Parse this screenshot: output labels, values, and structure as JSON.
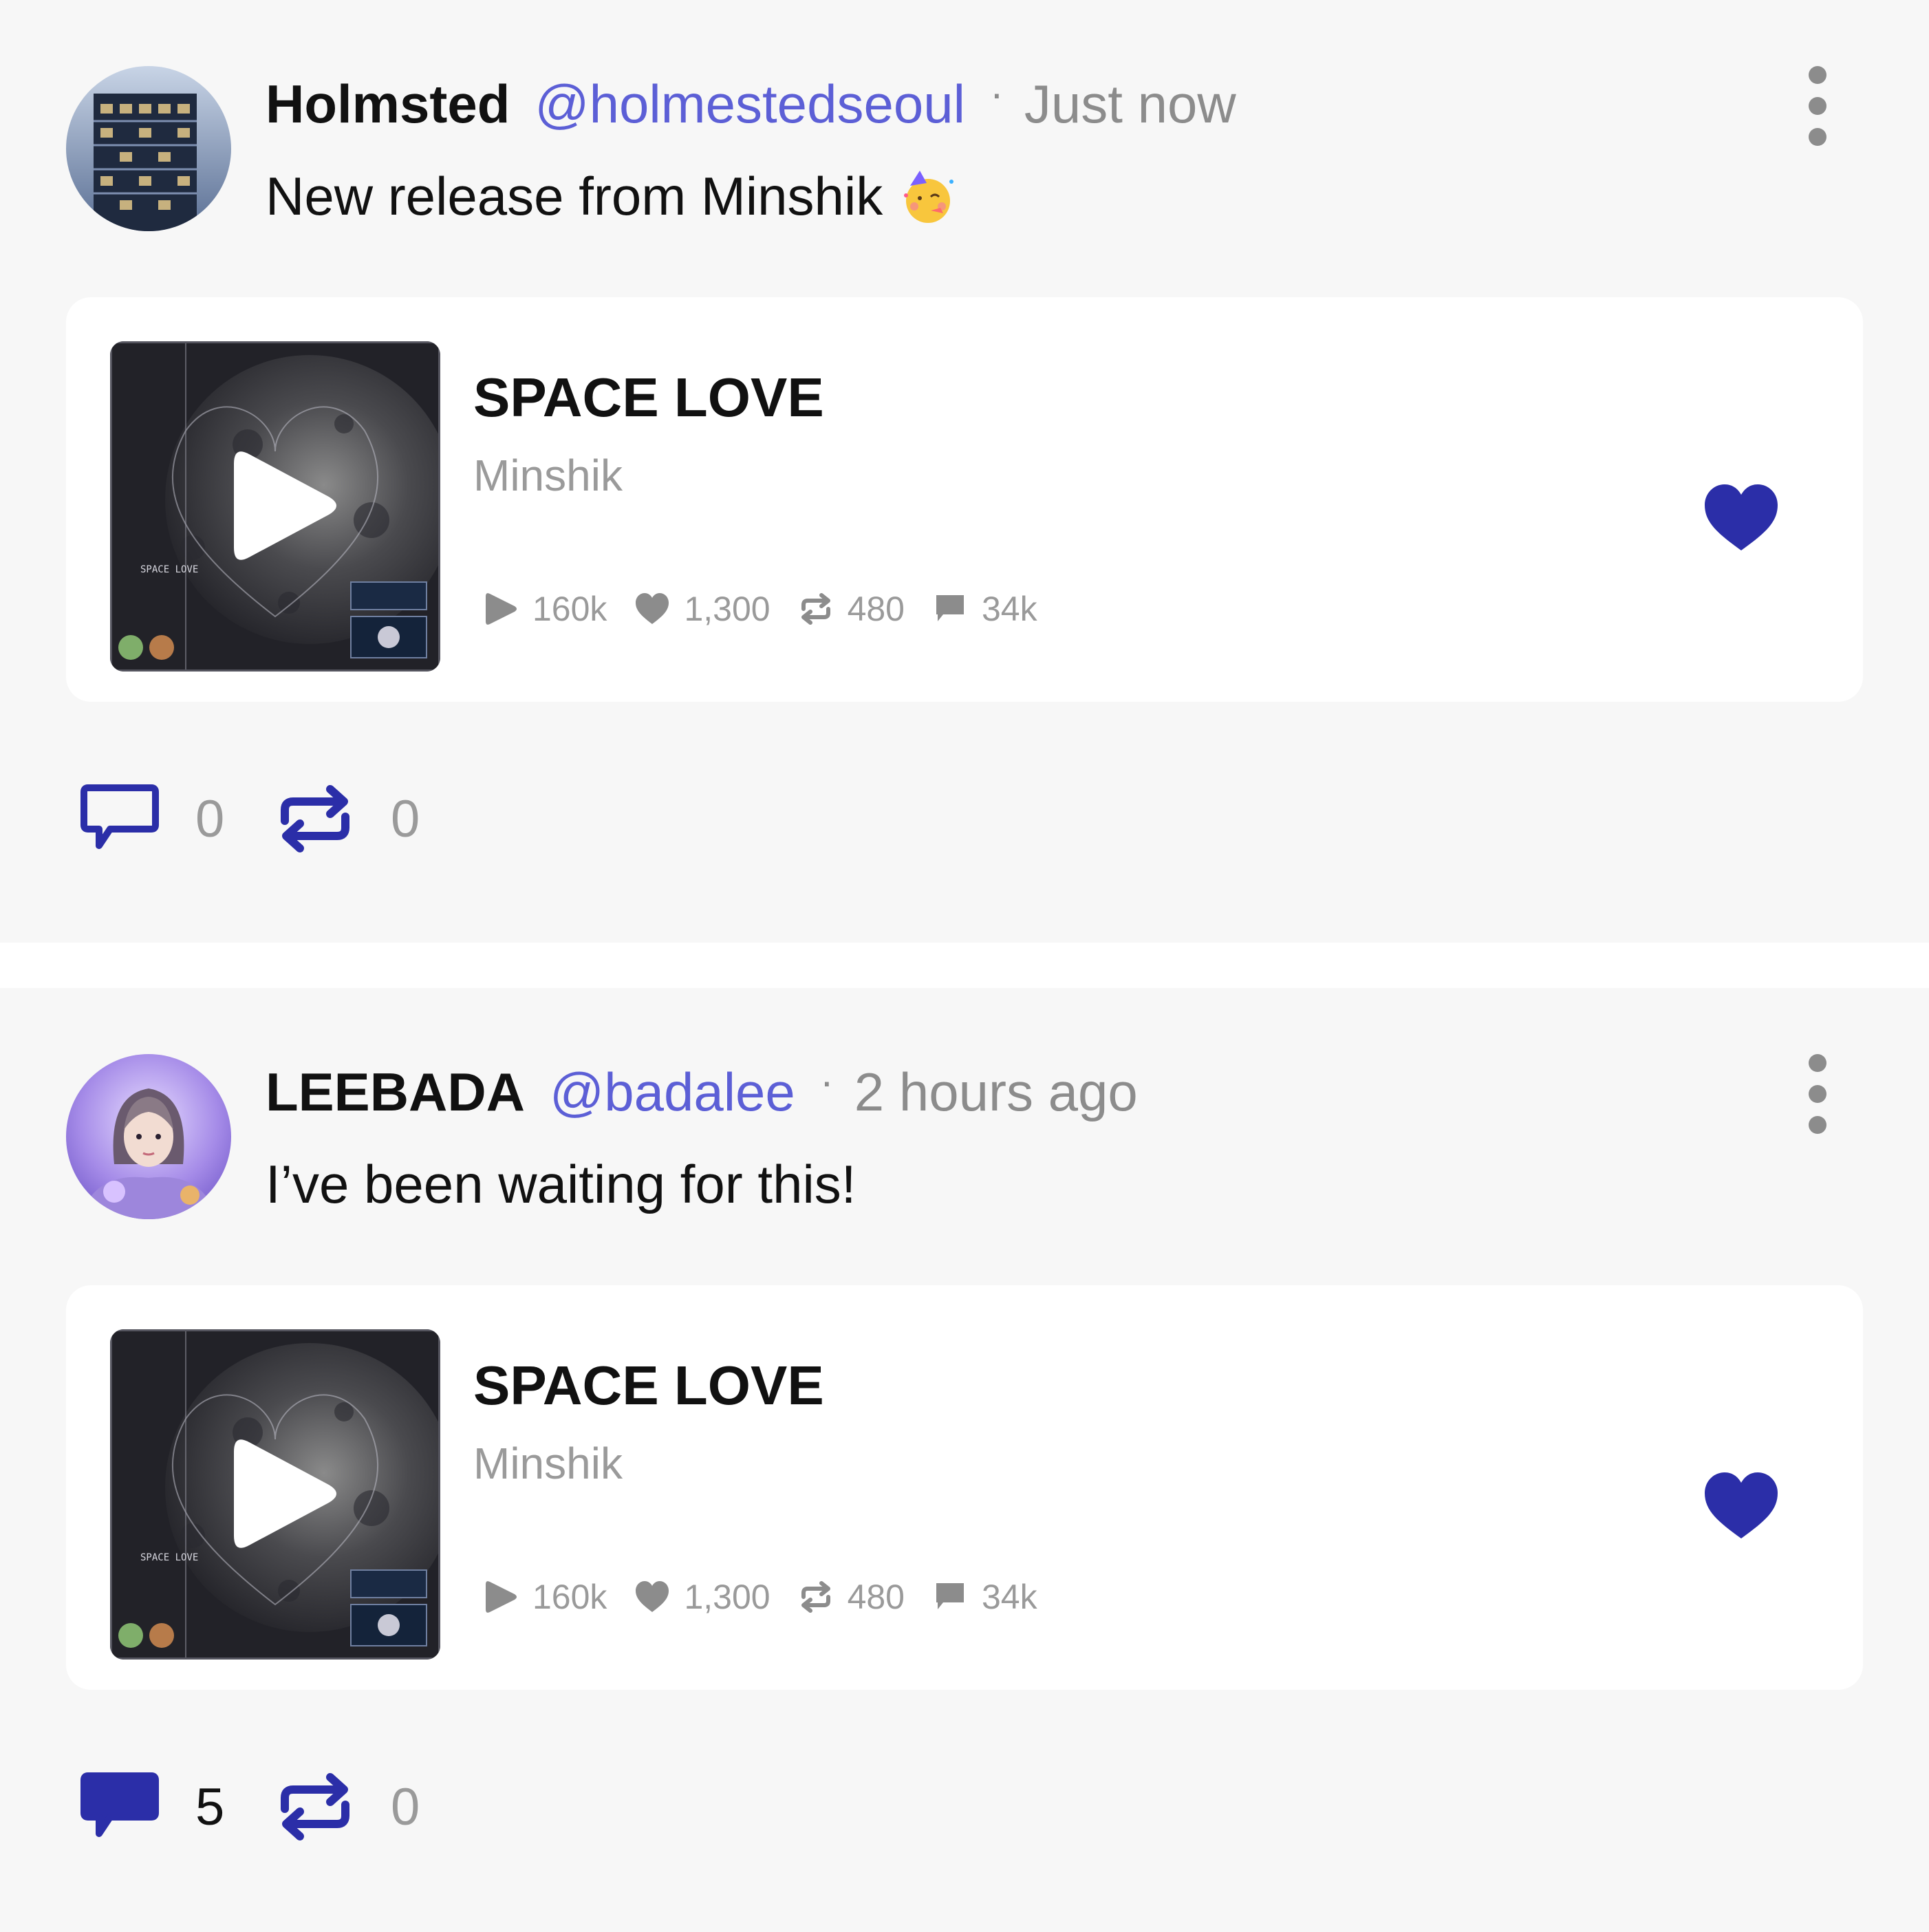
{
  "colors": {
    "accent": "#2b2ea8",
    "handle": "#5c5fd6",
    "muted": "#8c8c8c",
    "background": "#f7f7f7",
    "card": "#ffffff"
  },
  "posts": [
    {
      "author": {
        "name": "Holmsted",
        "handle": "@holmestedseoul",
        "avatar_icon": "building-avatar"
      },
      "separator": "·",
      "time": "Just now",
      "text": "New release from Minshik",
      "emoji": "partying-face-emoji",
      "track": {
        "title": "SPACE LOVE",
        "artist": "Minshik",
        "cover_text": "SPACE LOVE",
        "liked": true,
        "stats": {
          "plays": "160k",
          "likes": "1,300",
          "reposts": "480",
          "comments": "34k"
        }
      },
      "comments": {
        "count": "0",
        "filled": false
      },
      "reposts": {
        "count": "0"
      }
    },
    {
      "author": {
        "name": "LEEBADA",
        "handle": "@badalee",
        "avatar_icon": "portrait-avatar"
      },
      "separator": "·",
      "time": "2 hours ago",
      "text": "I’ve been waiting for this!",
      "track": {
        "title": "SPACE LOVE",
        "artist": "Minshik",
        "cover_text": "SPACE LOVE",
        "liked": true,
        "stats": {
          "plays": "160k",
          "likes": "1,300",
          "reposts": "480",
          "comments": "34k"
        }
      },
      "comments": {
        "count": "5",
        "filled": true
      },
      "reposts": {
        "count": "0"
      }
    }
  ]
}
